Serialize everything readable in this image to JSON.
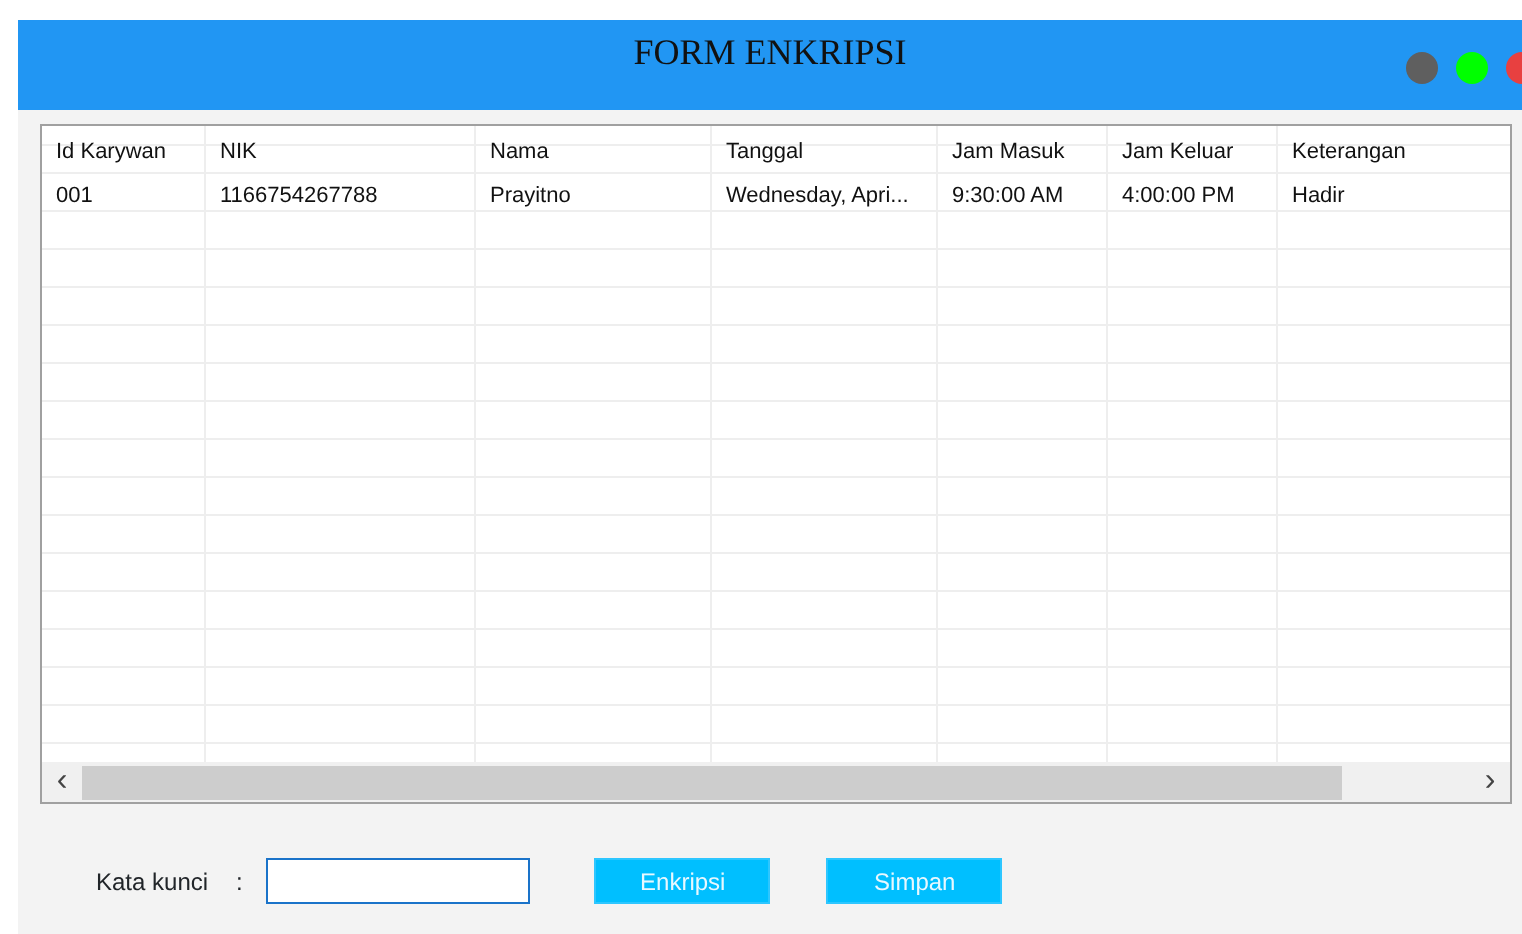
{
  "window": {
    "title": "FORM ENKRIPSI"
  },
  "window_controls": [
    {
      "color": "#5f5f5f"
    },
    {
      "color": "#00ff00"
    },
    {
      "color": "#e84040"
    }
  ],
  "table": {
    "columns": [
      "Id Karywan",
      "NIK",
      "Nama",
      "Tanggal",
      "Jam Masuk",
      "Jam Keluar",
      "Keterangan"
    ],
    "rows": [
      [
        "001",
        "1166754267788",
        "Prayitno",
        "Wednesday, Apri...",
        "9:30:00 AM",
        "4:00:00 PM",
        "Hadir"
      ]
    ],
    "scrollbar": {
      "left": "‹",
      "right": "›"
    }
  },
  "form": {
    "label": "Kata kunci",
    "colon": ":",
    "buttons": [
      "Enkripsi",
      "Simpan"
    ]
  }
}
